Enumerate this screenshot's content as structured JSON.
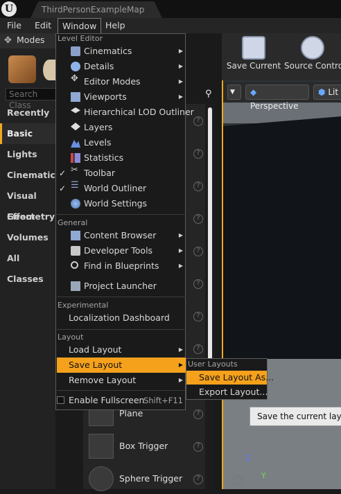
{
  "window": {
    "title": "ThirdPersonExampleMap"
  },
  "menubar": {
    "items": [
      "File",
      "Edit",
      "Window",
      "Help"
    ]
  },
  "modes": {
    "title": "Modes",
    "search_placeholder": "Search Class",
    "categories": [
      "Recently Pla",
      "Basic",
      "Lights",
      "Cinematic",
      "Visual Effect",
      "Geometry",
      "Volumes",
      "All Classes"
    ],
    "selected": "Basic"
  },
  "assets": [
    "Plane",
    "Box Trigger",
    "Sphere Trigger"
  ],
  "toolbar": {
    "save_current": "Save Current",
    "source_control": "Source Control"
  },
  "viewport": {
    "perspective": "Perspective",
    "lit": "Lit",
    "tooltip": "Save the current layout",
    "axis_z": "Z",
    "axis_y": "Y"
  },
  "window_menu": {
    "sections": {
      "level_editor": "Level Editor",
      "general": "General",
      "experimental": "Experimental",
      "layout": "Layout"
    },
    "level_editor": [
      {
        "label": "Cinematics",
        "icon": "cinematics-icon",
        "submenu": true
      },
      {
        "label": "Details",
        "icon": "details-icon",
        "submenu": true
      },
      {
        "label": "Editor Modes",
        "icon": "editor-modes-icon",
        "submenu": true
      },
      {
        "label": "Viewports",
        "icon": "viewports-icon",
        "submenu": true
      },
      {
        "label": "Hierarchical LOD Outliner",
        "icon": "hlod-icon",
        "submenu": false
      },
      {
        "label": "Layers",
        "icon": "layers-icon",
        "submenu": false
      },
      {
        "label": "Levels",
        "icon": "levels-icon",
        "submenu": false
      },
      {
        "label": "Statistics",
        "icon": "statistics-icon",
        "submenu": false
      },
      {
        "label": "Toolbar",
        "icon": "toolbar-icon",
        "submenu": false,
        "checked": true
      },
      {
        "label": "World Outliner",
        "icon": "world-outliner-icon",
        "submenu": false,
        "checked": true
      },
      {
        "label": "World Settings",
        "icon": "world-settings-icon",
        "submenu": false
      }
    ],
    "general": [
      {
        "label": "Content Browser",
        "icon": "content-browser-icon",
        "submenu": true
      },
      {
        "label": "Developer Tools",
        "icon": "developer-tools-icon",
        "submenu": true
      },
      {
        "label": "Find in Blueprints",
        "icon": "find-in-blueprints-icon",
        "submenu": true
      },
      {
        "label": "Project Launcher",
        "icon": "project-launcher-icon",
        "submenu": false
      }
    ],
    "experimental": [
      {
        "label": "Localization Dashboard"
      }
    ],
    "layout": [
      {
        "label": "Load Layout",
        "submenu": true
      },
      {
        "label": "Save Layout",
        "submenu": true,
        "highlighted": true
      },
      {
        "label": "Remove Layout",
        "submenu": true
      }
    ],
    "fullscreen": {
      "label": "Enable Fullscreen",
      "shortcut": "Shift+F11"
    }
  },
  "save_layout_submenu": {
    "section": "User Layouts",
    "items": [
      "Save Layout As...",
      "Export Layout..."
    ]
  },
  "colors": {
    "accent": "#f5a11c",
    "menu_bg": "#1a1a1a"
  }
}
